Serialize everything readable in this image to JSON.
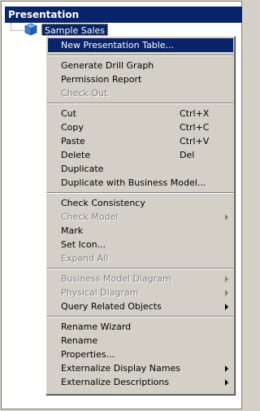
{
  "panel": {
    "title": "Presentation"
  },
  "tree": {
    "root_label": "Sample Sales",
    "root_icon": "cube-icon"
  },
  "menu": {
    "groups": [
      [
        {
          "label": "New Presentation Table...",
          "selected": true
        }
      ],
      [
        {
          "label": "Generate Drill Graph"
        },
        {
          "label": "Permission Report"
        },
        {
          "label": "Check Out",
          "disabled": true
        }
      ],
      [
        {
          "label": "Cut",
          "shortcut": "Ctrl+X"
        },
        {
          "label": "Copy",
          "shortcut": "Ctrl+C"
        },
        {
          "label": "Paste",
          "shortcut": "Ctrl+V"
        },
        {
          "label": "Delete",
          "shortcut": "Del"
        },
        {
          "label": "Duplicate"
        },
        {
          "label": "Duplicate with Business Model..."
        }
      ],
      [
        {
          "label": "Check Consistency"
        },
        {
          "label": "Check Model",
          "disabled": true,
          "submenu": true
        },
        {
          "label": "Mark"
        },
        {
          "label": "Set Icon..."
        },
        {
          "label": "Expand All",
          "disabled": true
        }
      ],
      [
        {
          "label": "Business Model Diagram",
          "disabled": true,
          "submenu": true
        },
        {
          "label": "Physical Diagram",
          "disabled": true,
          "submenu": true
        },
        {
          "label": "Query Related Objects",
          "submenu": true
        }
      ],
      [
        {
          "label": "Rename Wizard"
        },
        {
          "label": "Rename"
        },
        {
          "label": "Properties..."
        },
        {
          "label": "Externalize Display Names",
          "submenu": true
        },
        {
          "label": "Externalize Descriptions",
          "submenu": true
        }
      ]
    ]
  }
}
